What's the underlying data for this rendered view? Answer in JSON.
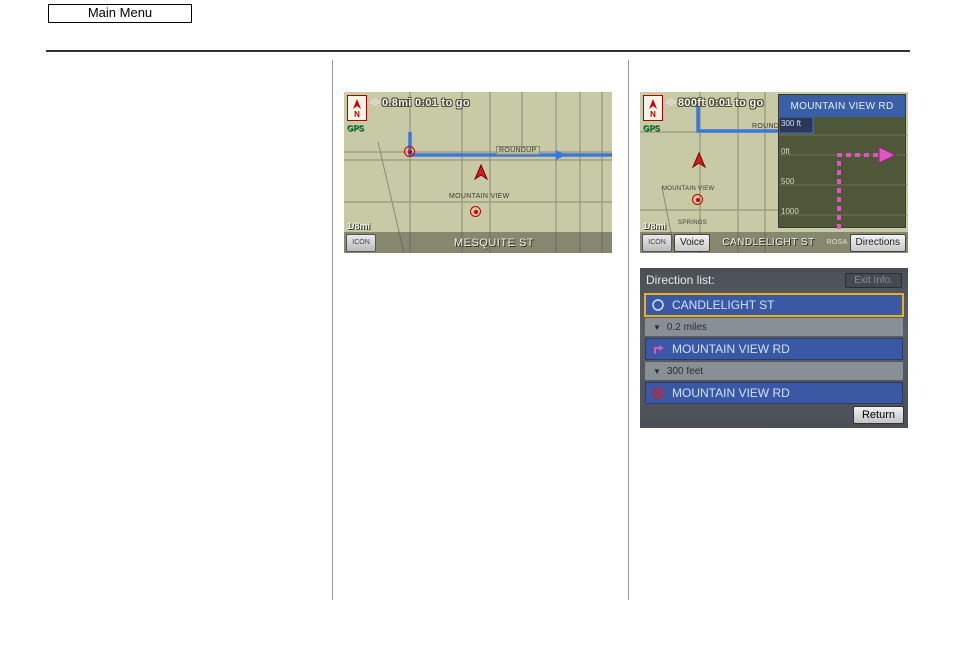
{
  "main_menu_label": "Main Menu",
  "map1": {
    "compass": "N",
    "gps_label": "GPS",
    "dist_to_go": "0.8mi 0:01 to go",
    "scale": "1/8mi",
    "street_bottom": "MESQUITE ST",
    "icon_btn": "ICON",
    "roads": {
      "roundup": "ROUNDUP",
      "mountain_view": "MOUNTAIN VIEW"
    }
  },
  "map2": {
    "compass": "N",
    "gps_label": "GPS",
    "dist_to_go": "800ft 0:01 to go",
    "scale": "1/8mi",
    "street_bottom": "CANDLELIGHT ST",
    "icon_btn": "ICON",
    "voice_btn": "Voice",
    "directions_btn": "Directions",
    "roads": {
      "roundup": "ROUND",
      "mountain_view": "MOUNTAIN VIEW",
      "springs": "SPRINGS",
      "rosa": "ROSA"
    },
    "preview": {
      "title": "MOUNTAIN VIEW RD",
      "ticks": [
        "300 ft",
        "0ft",
        "500",
        "1000"
      ]
    }
  },
  "directions": {
    "header": "Direction list:",
    "exit_info": "Exit Info.",
    "items": [
      {
        "label": "CANDLELIGHT ST",
        "selected": true,
        "icon": "circle"
      },
      {
        "gap": "0.2 miles"
      },
      {
        "label": "MOUNTAIN VIEW RD",
        "selected": false,
        "icon": "turn"
      },
      {
        "gap": "300 feet"
      },
      {
        "label": "MOUNTAIN VIEW RD",
        "selected": false,
        "icon": "target"
      }
    ],
    "return": "Return"
  }
}
